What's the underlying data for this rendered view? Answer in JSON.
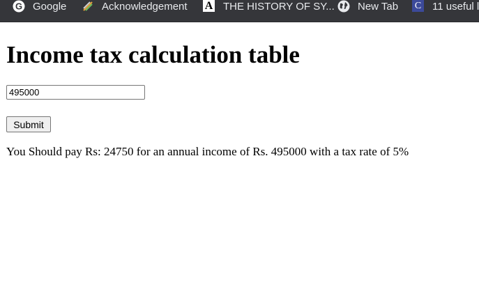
{
  "bookmarks": [
    {
      "label": "Google",
      "icon": "google-icon"
    },
    {
      "label": "Acknowledgement",
      "icon": "pencil-icon"
    },
    {
      "label": "THE HISTORY OF SY...",
      "icon": "letter-a-icon",
      "icon_text": "A"
    },
    {
      "label": "New Tab",
      "icon": "globe-icon"
    },
    {
      "label": "11 useful l",
      "icon": "letter-c-icon",
      "icon_text": "C"
    }
  ],
  "page": {
    "title": "Income tax calculation table",
    "income_input_value": "495000",
    "submit_label": "Submit",
    "result_text": "You Should pay Rs: 24750 for an annual income of Rs. 495000 with a tax rate of 5%"
  },
  "colors": {
    "bookmarks_bar_bg": "#35363a",
    "bookmarks_text": "#e8eaed",
    "page_bg": "#ffffff",
    "new_tab_icon_bg": "#3c4a9a"
  }
}
